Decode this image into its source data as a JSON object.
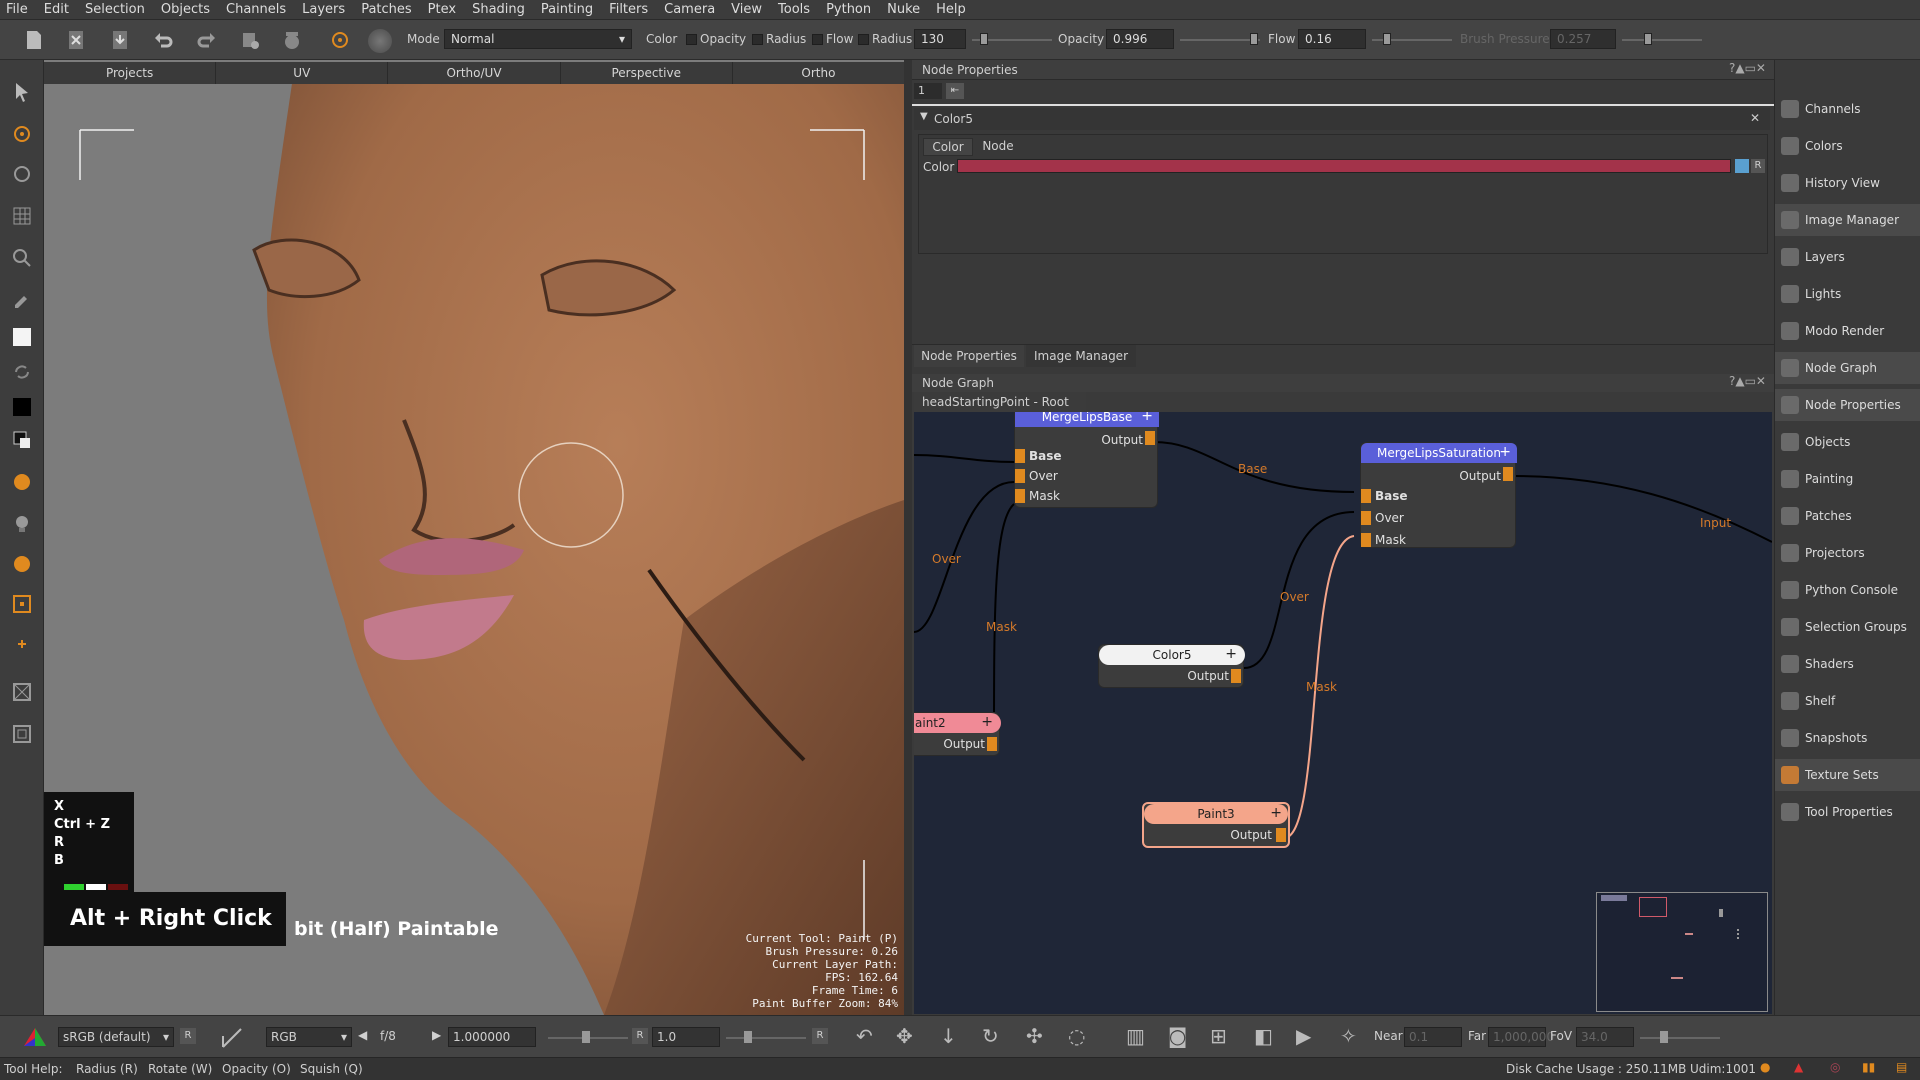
{
  "menu": [
    "File",
    "Edit",
    "Selection",
    "Objects",
    "Channels",
    "Layers",
    "Patches",
    "Ptex",
    "Shading",
    "Painting",
    "Filters",
    "Camera",
    "View",
    "Tools",
    "Python",
    "Nuke",
    "Help"
  ],
  "toolbar": {
    "mode_label": "Mode",
    "mode_value": "Normal",
    "color_label": "Color",
    "opacity_label": "Opacity",
    "radius_label": "Radius",
    "flow_label": "Flow",
    "radius_field_label": "Radius",
    "radius_value": "130",
    "opacity_field_label": "Opacity",
    "opacity_value": "0.996",
    "flow_field_label": "Flow",
    "flow_value": "0.16",
    "brush_pressure_label": "Brush Pressure",
    "brush_pressure_value": "0.257"
  },
  "viewport": {
    "tabs": [
      "Projects",
      "UV",
      "Ortho/UV",
      "Perspective",
      "Ortho"
    ],
    "shortcuts": [
      "X",
      "Ctrl + Z",
      "R",
      "B"
    ],
    "mouse_hint": "Alt + Right Click",
    "paint_info": "bit (Half) Paintable",
    "stats": [
      "Current Tool: Paint (P)",
      "Brush Pressure: 0.26",
      "Current Layer Path:",
      "FPS: 162.64",
      "Frame Time: 6",
      "Paint Buffer Zoom: 84%"
    ]
  },
  "node_properties": {
    "title": "Node Properties",
    "field_value": "1",
    "node_name": "Color5",
    "tabs": [
      "Color",
      "Node"
    ],
    "color_label": "Color",
    "color_value": "#a3334a",
    "r_label": "R",
    "bottom_tabs": [
      "Node Properties",
      "Image Manager"
    ]
  },
  "node_graph": {
    "title": "Node Graph",
    "breadcrumb": "headStartingPoint - Root",
    "nodes": {
      "merge_lips_base": {
        "name": "MergeLipsBase",
        "output": "Output",
        "inputs": [
          "Base",
          "Over",
          "Mask"
        ]
      },
      "merge_lips_saturation": {
        "name": "MergeLipsSaturation",
        "output": "Output",
        "inputs": [
          "Base",
          "Over",
          "Mask"
        ]
      },
      "color5": {
        "name": "Color5",
        "output": "Output"
      },
      "paint2": {
        "name": "aint2",
        "output": "Output"
      },
      "paint3": {
        "name": "Paint3",
        "output": "Output"
      }
    },
    "edge_labels": [
      "Over",
      "Mask",
      "Base",
      "Over",
      "Mask",
      "Input"
    ]
  },
  "sidebar": {
    "items": [
      "Channels",
      "Colors",
      "History View",
      "Image Manager",
      "Layers",
      "Lights",
      "Modo Render",
      "Node Graph",
      "Node Properties",
      "Objects",
      "Painting",
      "Patches",
      "Projectors",
      "Python Console",
      "Selection Groups",
      "Shaders",
      "Shelf",
      "Snapshots",
      "Texture Sets",
      "Tool Properties"
    ]
  },
  "bottombar": {
    "colorspace": "sRGB (default)",
    "r1": "R",
    "channel": "RGB",
    "fstop": "f/8",
    "exposure": "1.000000",
    "r2": "R",
    "gamma": "1.0",
    "r3": "R",
    "near_label": "Near",
    "near_value": "0.1",
    "far_label": "Far",
    "far_value": "1,000,000",
    "fov_label": "FoV",
    "fov_value": "34.0"
  },
  "statusbar": {
    "tool_help": "Tool Help:",
    "hints": [
      "Radius (R)",
      "Rotate (W)",
      "Opacity (O)",
      "Squish (Q)"
    ],
    "disk_cache": "Disk Cache Usage : 250.11MB",
    "udim": "Udim:1001"
  },
  "colors": {
    "accent_orange": "#e08a1f",
    "node_blue": "#5a5fd9",
    "node_salmon": "#f4a58a",
    "node_pink": "#f08a96",
    "graph_bg": "#1e2434"
  }
}
